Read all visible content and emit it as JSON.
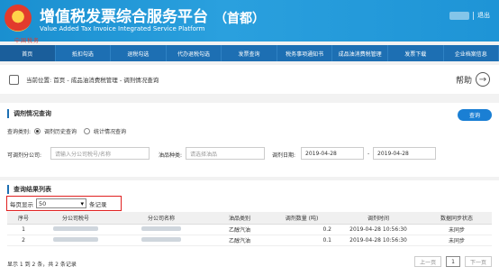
{
  "header": {
    "title_cn": "增值税发票综合服务平台",
    "title_en": "Value Added Tax Invoice Integrated Service Platform",
    "region": "（首都）",
    "right_link": "退出",
    "watermark": "中国税务"
  },
  "nav": [
    "首页",
    "抵扣勾选",
    "退税勾选",
    "代办退税勾选",
    "发票查询",
    "税务事项通知书",
    "成品油消费税管理",
    "发票下载",
    "企业档案信息"
  ],
  "breadcrumb": {
    "prefix": "当前位置:",
    "path": "首页 - 成品油消费税管理 - 调剂情况查询"
  },
  "help_label": "帮助",
  "query": {
    "title": "调剂情况查询",
    "button": "查询",
    "type_label": "查询类别:",
    "type_options": [
      "调剂历史查询",
      "统计情况查询"
    ],
    "company_label": "可调剂分公司:",
    "company_placeholder": "请输入分公司税号/名称",
    "oil_label": "油品种类:",
    "oil_placeholder": "请选择油品",
    "date_label": "调剂日期:",
    "date_from": "2019-04-28",
    "date_to": "2019-04-28",
    "date_sep": "-"
  },
  "results": {
    "title": "查询结果列表",
    "per_page_label": "每页显示",
    "per_page_value": "50",
    "per_page_suffix": "条记录",
    "columns": [
      "序号",
      "分公司税号",
      "分公司名称",
      "油品类别",
      "调剂数量 (吨)",
      "调剂时间",
      "数据同步状态"
    ],
    "rows": [
      {
        "no": "1",
        "category": "乙醇汽油",
        "qty": "0.2",
        "time": "2019-04-28 10:56:30",
        "status": "未同步"
      },
      {
        "no": "2",
        "category": "乙醇汽油",
        "qty": "0.1",
        "time": "2019-04-28 10:56:30",
        "status": "未同步"
      }
    ],
    "summary": "显示 1 到 2 条，共 2 条记录",
    "pager": {
      "prev": "上一页",
      "current": "1",
      "next": "下一页"
    }
  }
}
